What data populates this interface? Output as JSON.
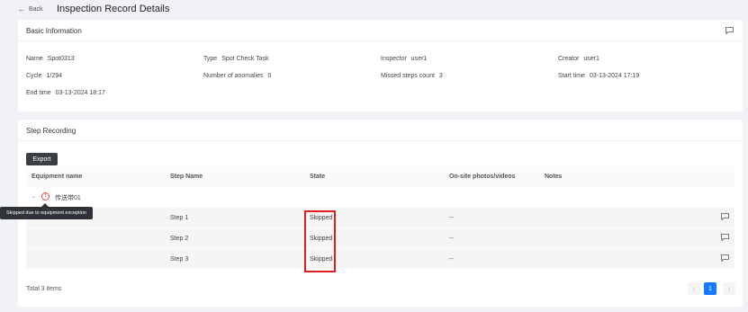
{
  "header": {
    "back_label": "Back",
    "title": "Inspection Record Details"
  },
  "basic": {
    "title": "Basic Information",
    "fields": [
      {
        "label": "Name",
        "value": "Spot0313"
      },
      {
        "label": "Type",
        "value": "Spot Check Task"
      },
      {
        "label": "Inspector",
        "value": "user1"
      },
      {
        "label": "Creator",
        "value": "user1"
      },
      {
        "label": "Cycle",
        "value": "1/294"
      },
      {
        "label": "Number of anomalies",
        "value": "0"
      },
      {
        "label": "Missed steps count",
        "value": "3"
      },
      {
        "label": "Start time",
        "value": "03-13-2024 17:19"
      },
      {
        "label": "End time",
        "value": "03-13-2024 18:17"
      }
    ]
  },
  "steps": {
    "title": "Step Recording",
    "export_label": "Export",
    "columns": [
      "Equipment name",
      "Step Name",
      "State",
      "On-site photos/videos",
      "Notes"
    ],
    "group": {
      "name": "传送带01"
    },
    "tooltip": "Skipped due to equipment exception",
    "rows": [
      {
        "step": "Step 1",
        "state": "Skipped",
        "media": "--"
      },
      {
        "step": "Step 2",
        "state": "Skipped",
        "media": "--"
      },
      {
        "step": "Step 3",
        "state": "Skipped",
        "media": "--"
      }
    ],
    "total": "Total 3 items",
    "pager": {
      "prev": "‹",
      "page": "1",
      "next": "›"
    }
  },
  "icons": {
    "back": "arrow-left-icon",
    "comment": "comment-icon",
    "warning": "exclamation-circle-icon",
    "expand": "chevron-down-icon"
  },
  "colors": {
    "primary": "#1677ff",
    "export_button": "#3a3f45",
    "highlight": "#e01e1e",
    "warning": "#e5484d"
  }
}
